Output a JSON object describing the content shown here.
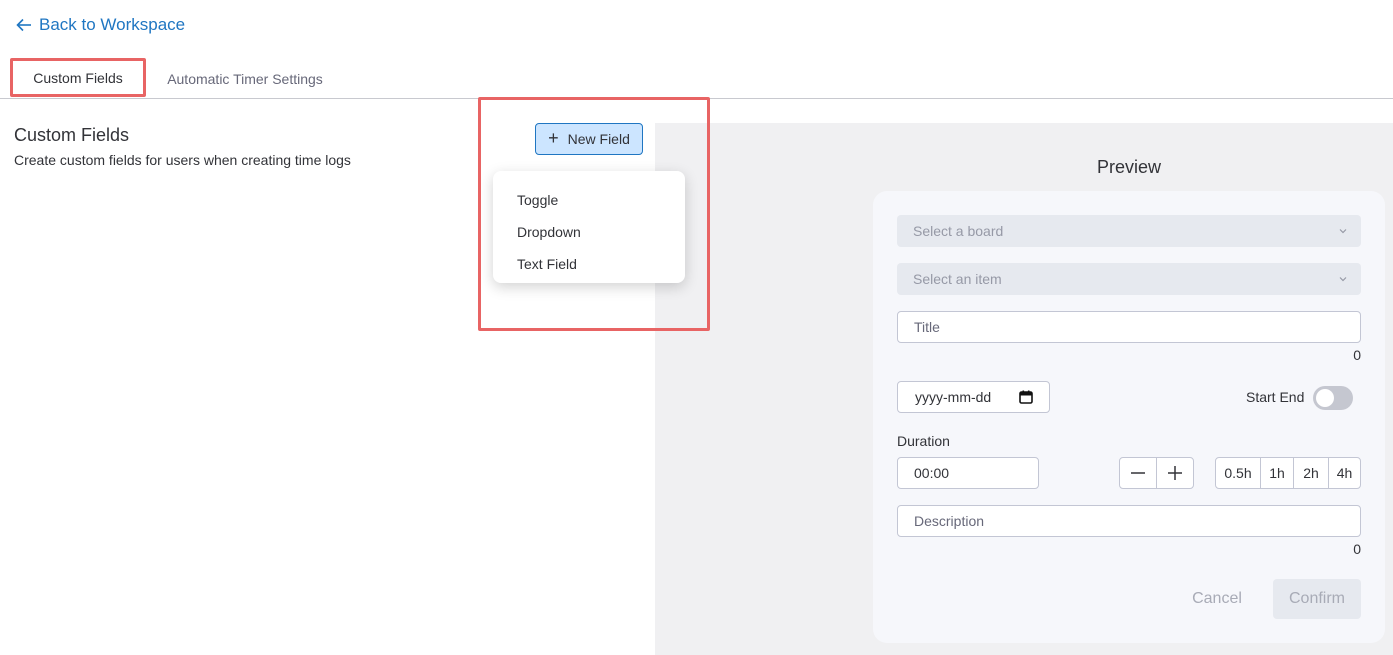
{
  "nav": {
    "back_label": "Back to Workspace"
  },
  "tabs": [
    {
      "label": "Custom Fields",
      "active": true
    },
    {
      "label": "Automatic Timer Settings",
      "active": false
    }
  ],
  "section": {
    "title": "Custom Fields",
    "subtitle": "Create custom fields for users when creating time logs"
  },
  "new_field": {
    "plus": "+",
    "label": "New Field",
    "menu_items": [
      "Toggle",
      "Dropdown",
      "Text Field"
    ]
  },
  "preview": {
    "title": "Preview",
    "board_placeholder": "Select a board",
    "item_placeholder": "Select an item",
    "title_placeholder": "Title",
    "title_count": "0",
    "date_value": "yyyy-mm-dd",
    "start_end_label": "Start End",
    "toggle_on": false,
    "duration_label": "Duration",
    "duration_value": "00:00",
    "quick_durations": [
      "0.5h",
      "1h",
      "2h",
      "4h"
    ],
    "description_placeholder": "Description",
    "description_count": "0",
    "cancel_label": "Cancel",
    "confirm_label": "Confirm"
  },
  "colors": {
    "link": "#1f76c2",
    "highlight": "#e86464",
    "primary_light": "#cce5ff",
    "panel_bg": "#f0f0f2"
  }
}
